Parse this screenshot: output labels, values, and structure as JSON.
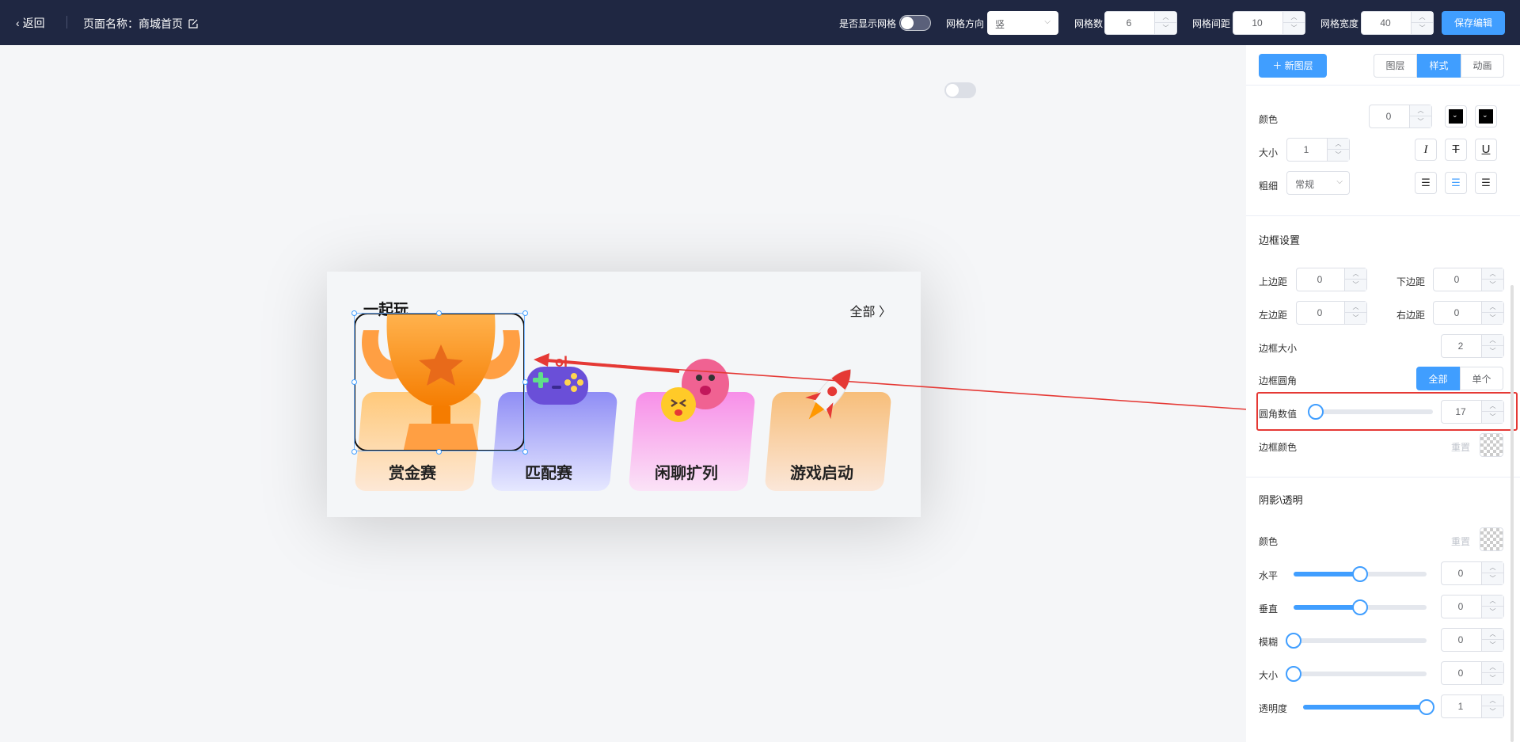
{
  "topbar": {
    "back_label": "返回",
    "page_name": "页面名称：商城首页",
    "show_grid_label": "是否显示网格",
    "grid_direction_label": "网格方向",
    "grid_direction_value": "竖",
    "grid_count_label": "网格数",
    "grid_count_value": "6",
    "grid_gap_label": "网格间距",
    "grid_gap_value": "10",
    "grid_width_label": "网格宽度",
    "grid_width_value": "40",
    "save_label": "保存编辑"
  },
  "preview": {
    "title": "一起玩",
    "all_label": "全部 〉",
    "cards": [
      {
        "label": "赏金赛",
        "icon": "trophy-icon"
      },
      {
        "label": "匹配赛",
        "icon": "gamepad-icon"
      },
      {
        "label": "闲聊扩列",
        "icon": "chat-emoji-icon"
      },
      {
        "label": "游戏启动",
        "icon": "rocket-icon"
      }
    ]
  },
  "panel": {
    "new_layer_label": "＋ 新图层",
    "tabs": [
      "图层",
      "样式",
      "动画"
    ],
    "active_tab": "样式",
    "font": {
      "color_label": "颜色",
      "color_value": "0",
      "size_label": "大小",
      "size_value": "1",
      "weight_label": "粗细",
      "weight_value": "常规"
    },
    "border": {
      "section_title": "边框设置",
      "top_label": "上边距",
      "top_value": "0",
      "bottom_label": "下边距",
      "bottom_value": "0",
      "left_label": "左边距",
      "left_value": "0",
      "right_label": "右边距",
      "right_value": "0",
      "size_label": "边框大小",
      "size_value": "2",
      "radius_label": "边框圆角",
      "radius_all": "全部",
      "radius_single": "单个",
      "radius_value_label": "圆角数值",
      "radius_value": "17",
      "radius_fraction": 0.0,
      "color_label": "边框颜色",
      "reset_label": "重置"
    },
    "shadow": {
      "section_title": "阴影\\透明",
      "color_label": "颜色",
      "reset_label": "重置",
      "h_label": "水平",
      "h_value": "0",
      "h_fraction": 0.5,
      "v_label": "垂直",
      "v_value": "0",
      "v_fraction": 0.5,
      "blur_label": "模糊",
      "blur_value": "0",
      "blur_fraction": 0.0,
      "size_label": "大小",
      "size_value": "0",
      "size_fraction": 0.0,
      "opacity_label": "透明度",
      "opacity_value": "1",
      "opacity_fraction": 1.0
    }
  },
  "colors": {
    "topbar_bg": "#1f2742",
    "accent": "#409eff",
    "highlight": "#e53935"
  }
}
